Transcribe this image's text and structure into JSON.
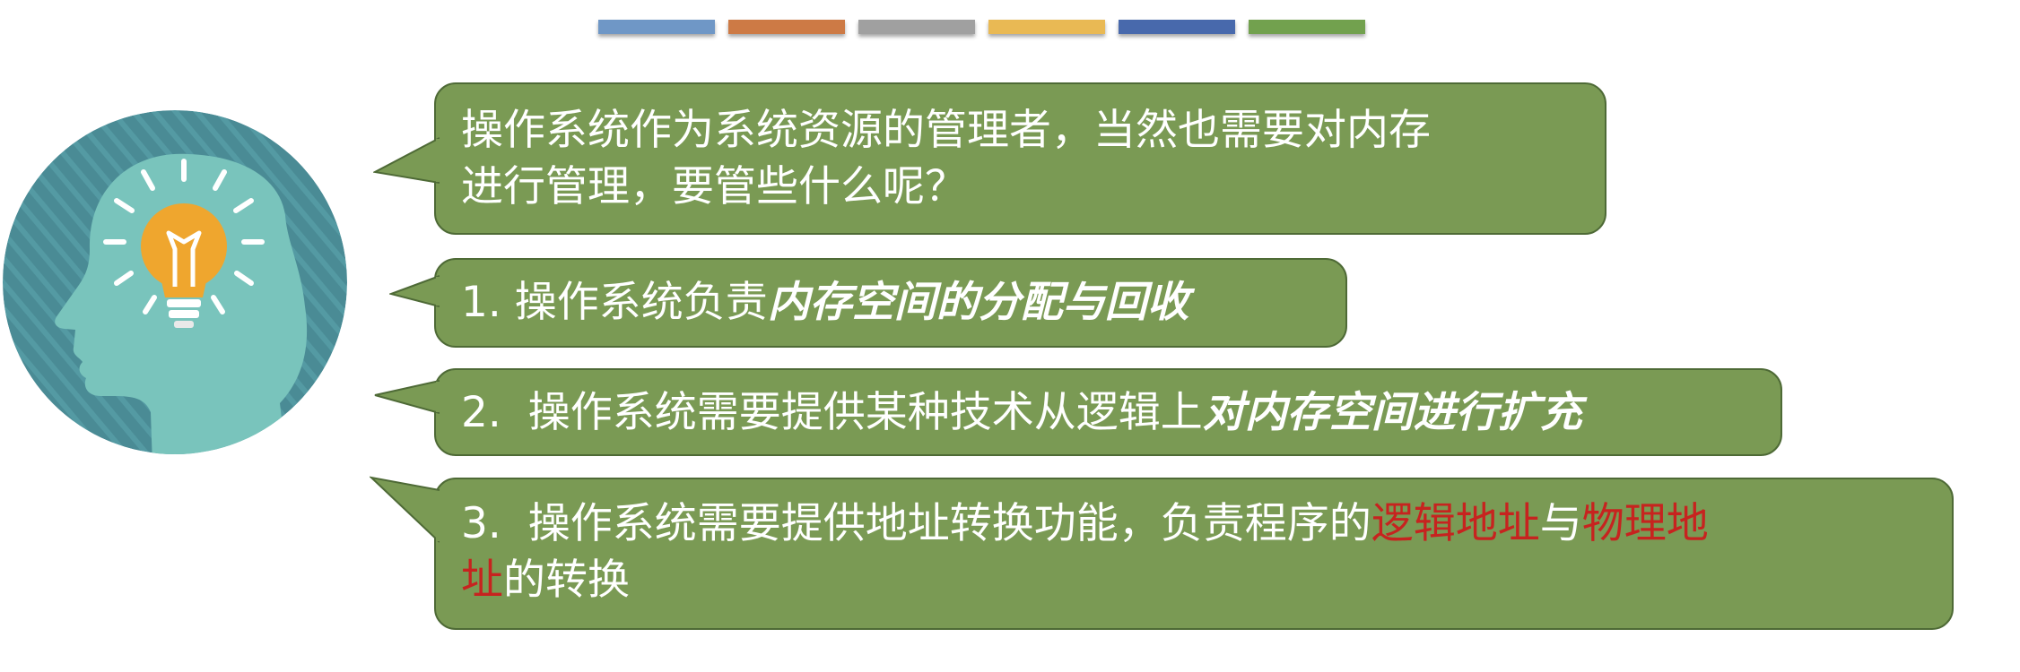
{
  "colors": {
    "bars": [
      "#6f97c6",
      "#cd7a45",
      "#a0a0a0",
      "#e9b954",
      "#4869ac",
      "#72a14e"
    ],
    "bubble_fill": "#7a9a54",
    "bubble_border": "#4e6a36",
    "highlight_red": "#c7231f",
    "head_circle": "#4a8b95",
    "head_silhouette": "#79c4bc",
    "bulb": "#efa62e"
  },
  "illustration": {
    "icon": "head-lightbulb-icon"
  },
  "bubbles": [
    {
      "line1": "操作系统作为系统资源的管理者，当然也需要对内存",
      "line2": "进行管理，要管些什么呢？"
    },
    {
      "prefix": "1. 操作系统负责",
      "emphasis": "内存空间的分配与回收"
    },
    {
      "prefix": "2.  操作系统需要提供某种技术从逻辑上",
      "emphasis": "对内存空间进行扩充"
    },
    {
      "prefix": "3.  操作系统需要提供地址转换功能，负责程序的",
      "red1": "逻辑地址",
      "mid": "与",
      "red2": "物理地",
      "red3": "址",
      "suffix": "的转换"
    }
  ]
}
